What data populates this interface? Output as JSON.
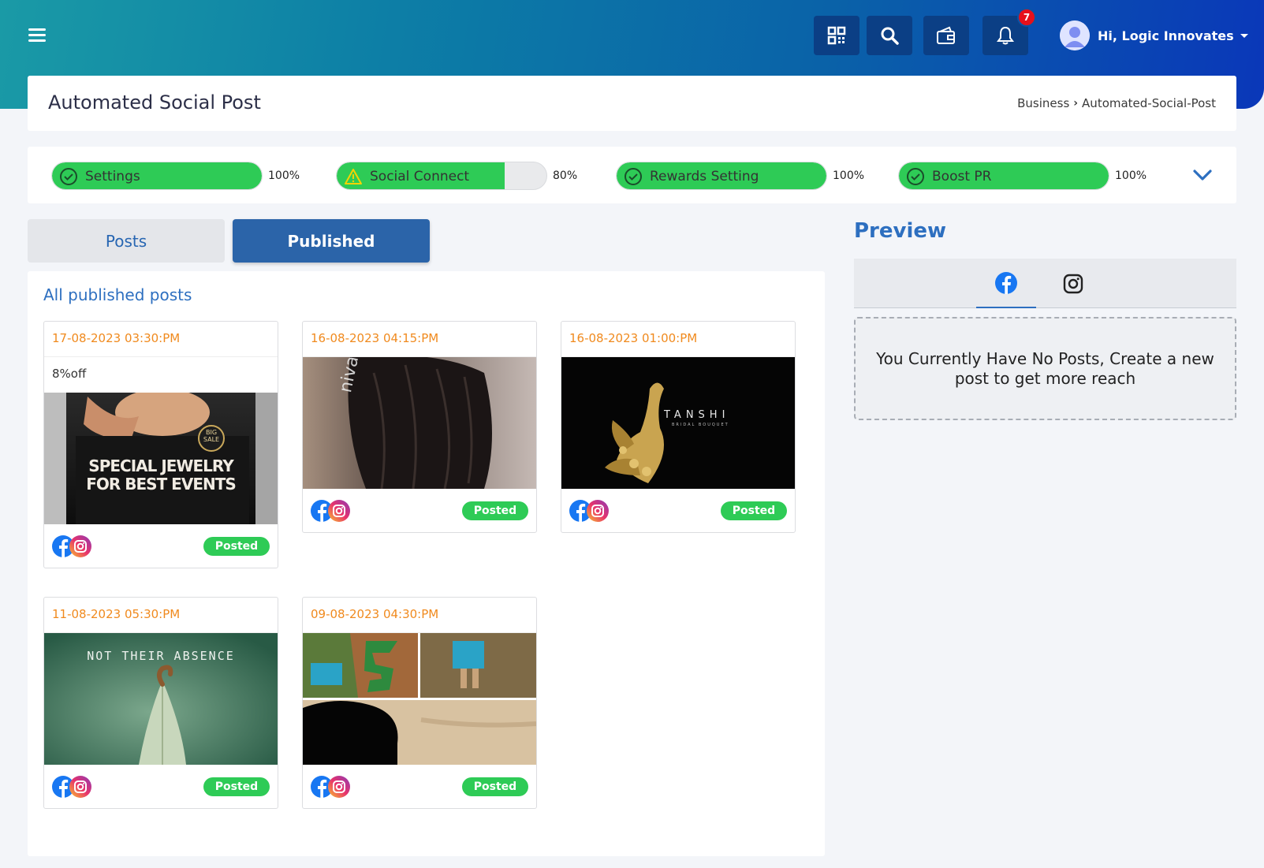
{
  "header": {
    "user_greeting": "Hi, Logic Innovates",
    "notification_count": "7",
    "icons": [
      "menu-icon",
      "qr-code-icon",
      "search-icon",
      "wallet-icon",
      "bell-icon",
      "user-avatar-icon"
    ]
  },
  "page": {
    "title": "Automated Social Post",
    "breadcrumb": [
      "Business",
      "Automated-Social-Post"
    ]
  },
  "progress": [
    {
      "label": "Settings",
      "percent_text": "100%",
      "value": 100,
      "status": "complete"
    },
    {
      "label": "Social Connect",
      "percent_text": "80%",
      "value": 80,
      "status": "warning"
    },
    {
      "label": "Rewards Setting",
      "percent_text": "100%",
      "value": 100,
      "status": "complete"
    },
    {
      "label": "Boost PR",
      "percent_text": "100%",
      "value": 100,
      "status": "complete"
    }
  ],
  "tabs": {
    "posts": "Posts",
    "published": "Published",
    "active": "published"
  },
  "list": {
    "title": "All published posts",
    "posts": [
      {
        "date": "17-08-2023 03:30:PM",
        "caption": "8%off",
        "status": "Posted",
        "image_text": [
          "SPECIAL JEWELRY",
          "FOR BEST EVENTS",
          "BIG",
          "SALE"
        ]
      },
      {
        "date": "16-08-2023 04:15:PM",
        "caption": "",
        "status": "Posted",
        "image_text": [
          "nivah_weddin"
        ]
      },
      {
        "date": "16-08-2023 01:00:PM",
        "caption": "",
        "status": "Posted",
        "image_text": [
          "TANSHI",
          "BRIDAL BOUQUET"
        ]
      },
      {
        "date": "11-08-2023 05:30:PM",
        "caption": "",
        "status": "Posted",
        "image_text": [
          "NOT THEIR ABSENCE"
        ]
      },
      {
        "date": "09-08-2023 04:30:PM",
        "caption": "",
        "status": "Posted",
        "image_text": []
      }
    ]
  },
  "preview": {
    "title": "Preview",
    "tabs": [
      "facebook-icon",
      "instagram-icon"
    ],
    "empty_message": "You Currently Have No Posts, Create a new post to get more reach"
  },
  "colors": {
    "accent": "#2d6fc0",
    "success": "#2ecb56",
    "date": "#f08a1e",
    "badge": "#e6101b"
  }
}
